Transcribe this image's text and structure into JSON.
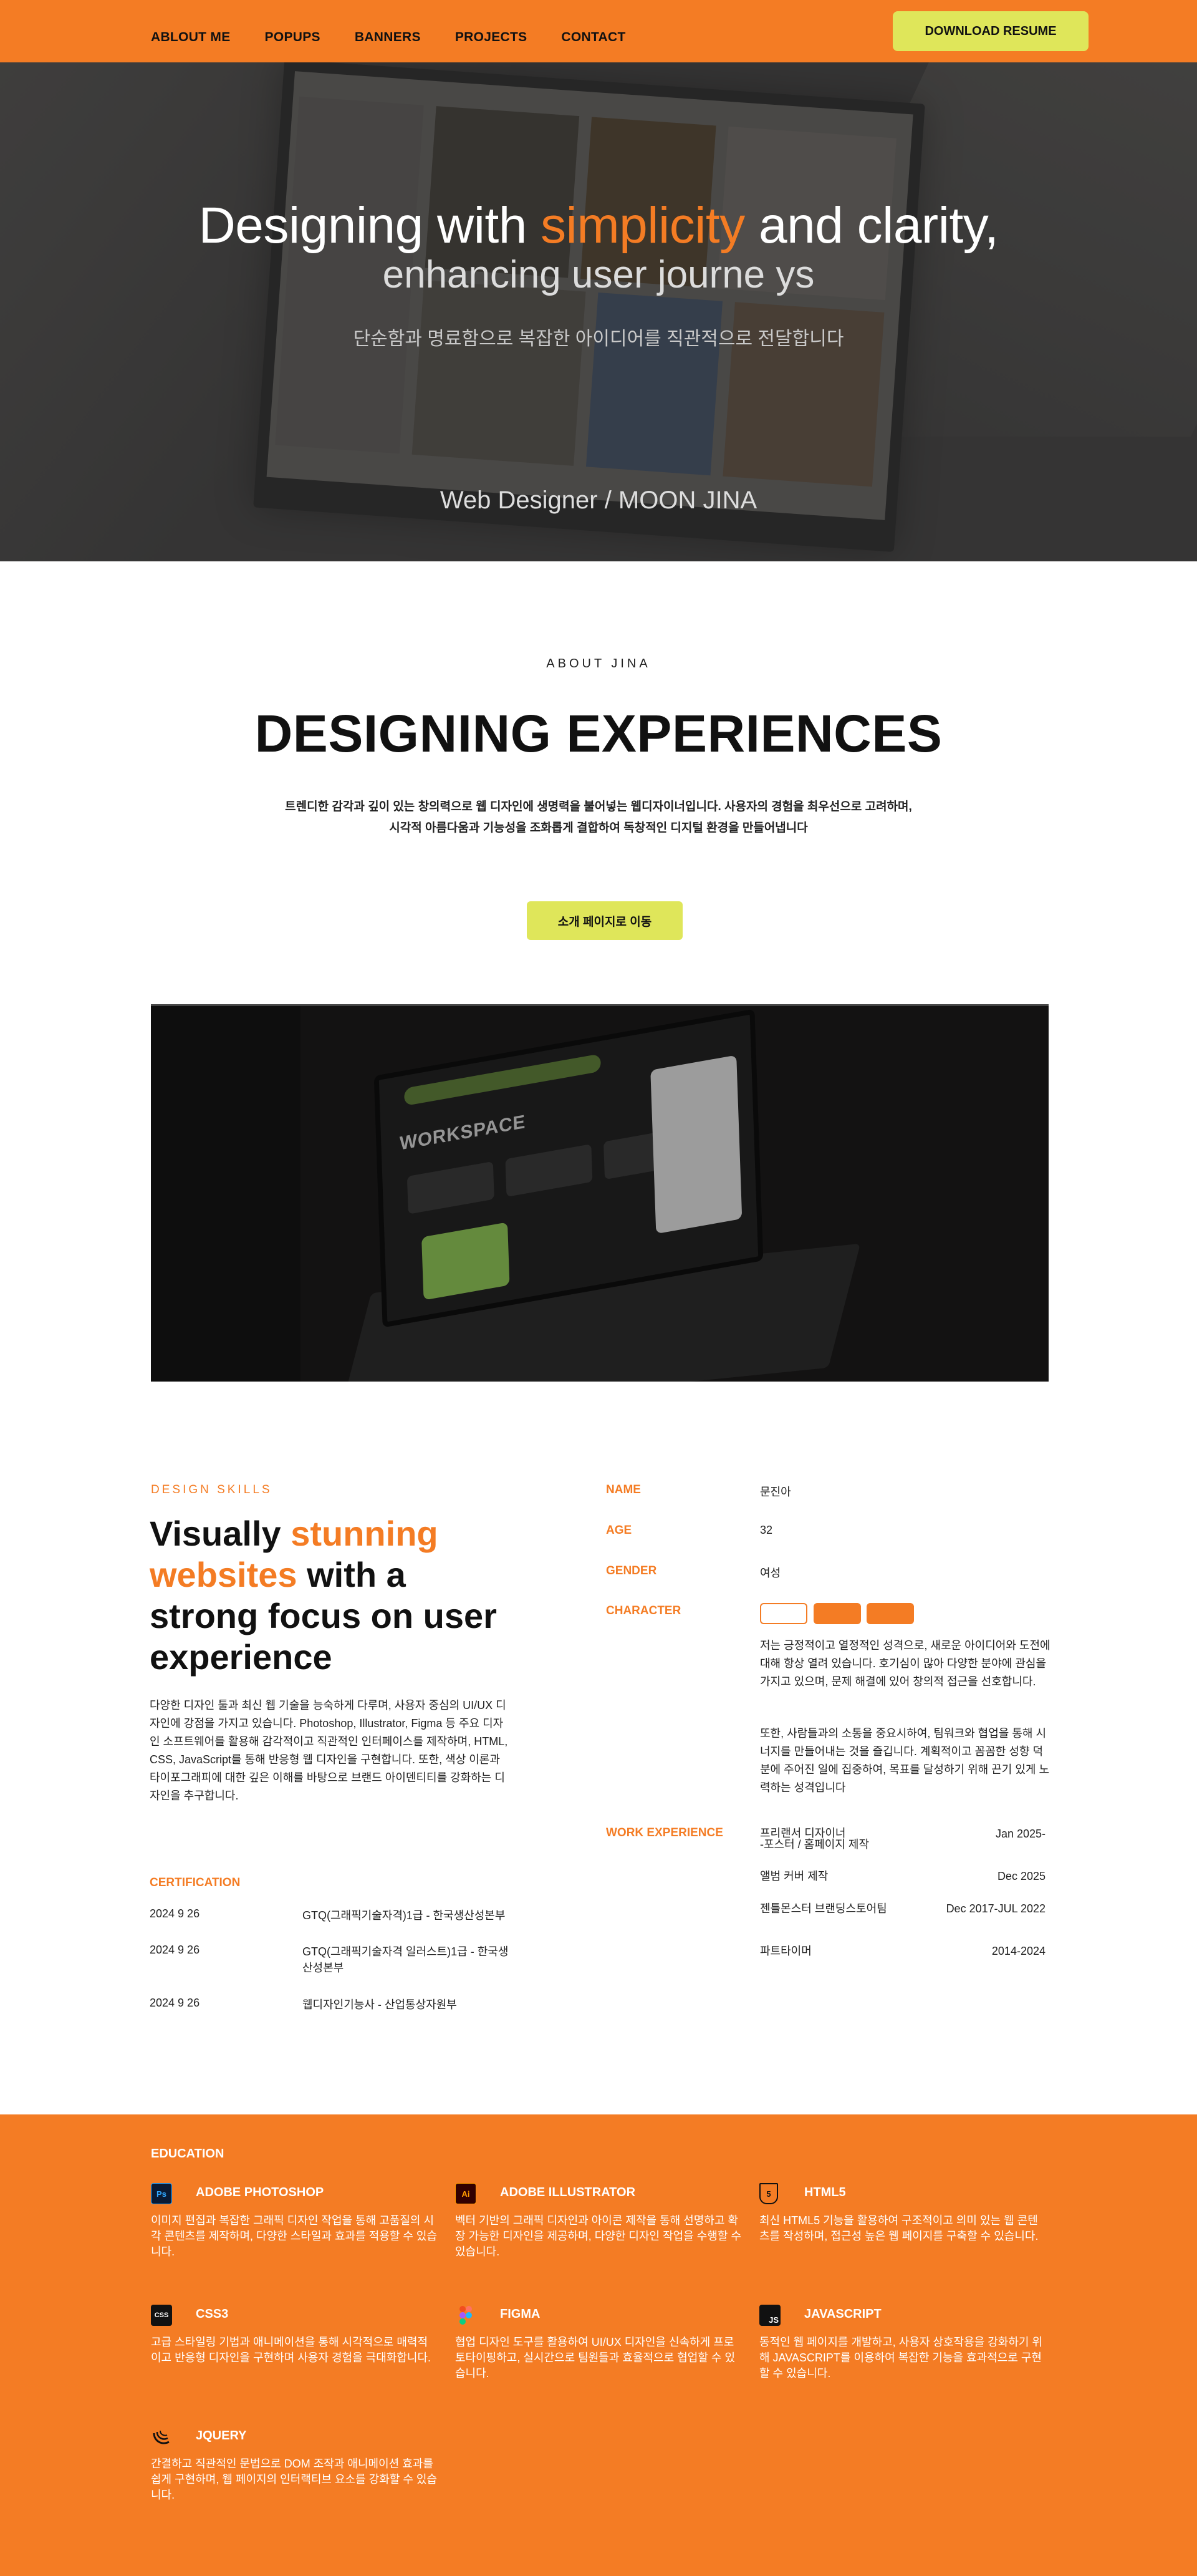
{
  "nav": {
    "links": [
      "ABLOUT ME",
      "POPUPS",
      "BANNERS",
      "PROJECTS",
      "CONTACT"
    ],
    "download_label": "DOWNLOAD RESUME"
  },
  "hero": {
    "title_pre": "Designing with ",
    "title_accent": "simplicity",
    "title_post": " and clarity,",
    "subtitle": "enhancing user journe ys",
    "korean": "단순함과 명료함으로 복잡한 아이디어를 직관적으로 전달합니다",
    "role": "Web Designer / MOON JINA"
  },
  "about": {
    "eyebrow": "ABOUT JINA",
    "title": "DESIGNING EXPERIENCES",
    "desc_line1": "트렌디한 감각과 깊이 있는 창의력으로 웹 디자인에 생명력을 불어넣는 웹디자이너입니다. 사용자의 경험을 최우선으로 고려하며,",
    "desc_line2": "시각적 아름다움과 기능성을 조화롭게 결합하여 독창적인 디지털 환경을 만들어냅니다",
    "button_label": "소개 페이지로 이동",
    "laptop_title": "WORKSPACE"
  },
  "skills": {
    "eyebrow": "DESIGN SKILLS",
    "title_1": "Visually ",
    "title_accent": "stunning websites",
    "title_2": " with a strong focus on user experience",
    "desc": "다양한 디자인 툴과 최신 웹 기술을 능숙하게 다루며, 사용자 중심의 UI/UX 디자인에 강점을 가지고 있습니다. Photoshop, Illustrator, Figma 등 주요 디자인 소프트웨어를 활용해 감각적이고 직관적인 인터페이스를 제작하며, HTML, CSS, JavaScript를 통해 반응형 웹 디자인을 구현합니다. 또한, 색상 이론과 타이포그래피에 대한 깊은 이해를 바탕으로 브랜드 아이덴티티를 강화하는 디자인을 추구합니다."
  },
  "certification": {
    "label": "CERTIFICATION",
    "items": [
      {
        "date": "2024 9 26",
        "name": "GTQ(그래픽기술자격)1급 - 한국생산성본부"
      },
      {
        "date": "2024 9 26",
        "name": "GTQ(그래픽기술자격 일러스트)1급 - 한국생산성본부"
      },
      {
        "date": "2024 9 26",
        "name": "웹디자인기능사 - 산업통상자원부"
      }
    ]
  },
  "profile": {
    "name_label": "NAME",
    "name_value": "문진아",
    "age_label": "AGE",
    "age_value": "32",
    "gender_label": "GENDER",
    "gender_value": "여성",
    "character_label": "CHARACTER",
    "character_p1": "저는 긍정적이고 열정적인 성격으로, 새로운 아이디어와 도전에 대해 항상 열려 있습니다. 호기심이 많아 다양한 분야에 관심을 가지고 있으며, 문제 해결에 있어 창의적 접근을 선호합니다.",
    "character_p2": "또한, 사람들과의 소통을 중요시하여, 팀워크와 협업을 통해 시너지를 만들어내는 것을 즐깁니다. 계획적이고 꼼꼼한 성향 덕분에 주어진 일에 집중하여, 목표를 달성하기 위해 끈기 있게 노력하는 성격입니다",
    "work_label": "WORK EXPERIENCE",
    "work": [
      {
        "name": "프리랜서 디자이너\n-포스터 / 홈페이지 제작",
        "date": "Jan 2025-"
      },
      {
        "name": "앨범 커버 제작",
        "date": "Dec 2025"
      },
      {
        "name": "젠틀몬스터 브랜딩스토어팀",
        "date": "Dec 2017-JUL 2022"
      },
      {
        "name": "파트타이머",
        "date": "2014-2024"
      }
    ]
  },
  "education": {
    "label": "EDUCATION",
    "items": [
      {
        "icon": "photoshop-icon",
        "icon_text": "Ps",
        "name": "ADOBE PHOTOSHOP",
        "desc": "이미지 편집과 복잡한 그래픽 디자인 작업을 통해 고품질의 시각 콘텐츠를 제작하며, 다양한 스타일과 효과를 적용할 수 있습니다."
      },
      {
        "icon": "illustrator-icon",
        "icon_text": "Ai",
        "name": "ADOBE ILLUSTRATOR",
        "desc": "벡터 기반의 그래픽 디자인과 아이콘 제작을 통해 선명하고 확장 가능한 디자인을 제공하며, 다양한 디자인 작업을 수행할 수 있습니다."
      },
      {
        "icon": "html5-icon",
        "icon_text": "5",
        "name": "HTML5",
        "desc": "최신 HTML5 기능을 활용하여 구조적이고 의미 있는 웹 콘텐츠를 작성하며, 접근성 높은 웹 페이지를 구축할 수 있습니다."
      },
      {
        "icon": "css3-icon",
        "icon_text": "CSS",
        "name": "CSS3",
        "desc": "고급 스타일링 기법과 애니메이션을 통해 시각적으로 매력적이고 반응형 디자인을 구현하며 사용자 경험을 극대화합니다."
      },
      {
        "icon": "figma-icon",
        "icon_text": "",
        "name": "FIGMA",
        "desc": "협업 디자인 도구를 활용하여 UI/UX 디자인을 신속하게 프로토타이핑하고, 실시간으로 팀원들과 효율적으로 협업할 수 있습니다."
      },
      {
        "icon": "javascript-icon",
        "icon_text": "JS",
        "name": "JAVASCRIPT",
        "desc": "동적인 웹 페이지를 개발하고, 사용자 상호작용을 강화하기 위해 JAVASCRIPT를 이용하여 복잡한 기능을 효과적으로 구현할 수 있습니다."
      },
      {
        "icon": "jquery-icon",
        "icon_text": "",
        "name": "JQUERY",
        "desc": "간결하고 직관적인 문법으로 DOM 조작과 애니메이션 효과를 쉽게 구현하며, 웹 페이지의 인터랙티브 요소를 강화할 수 있습니다."
      }
    ]
  },
  "colors": {
    "brand_orange": "#f47c24",
    "accent_lime": "#dfe65a",
    "hero_dark": "#3c3b3b"
  }
}
